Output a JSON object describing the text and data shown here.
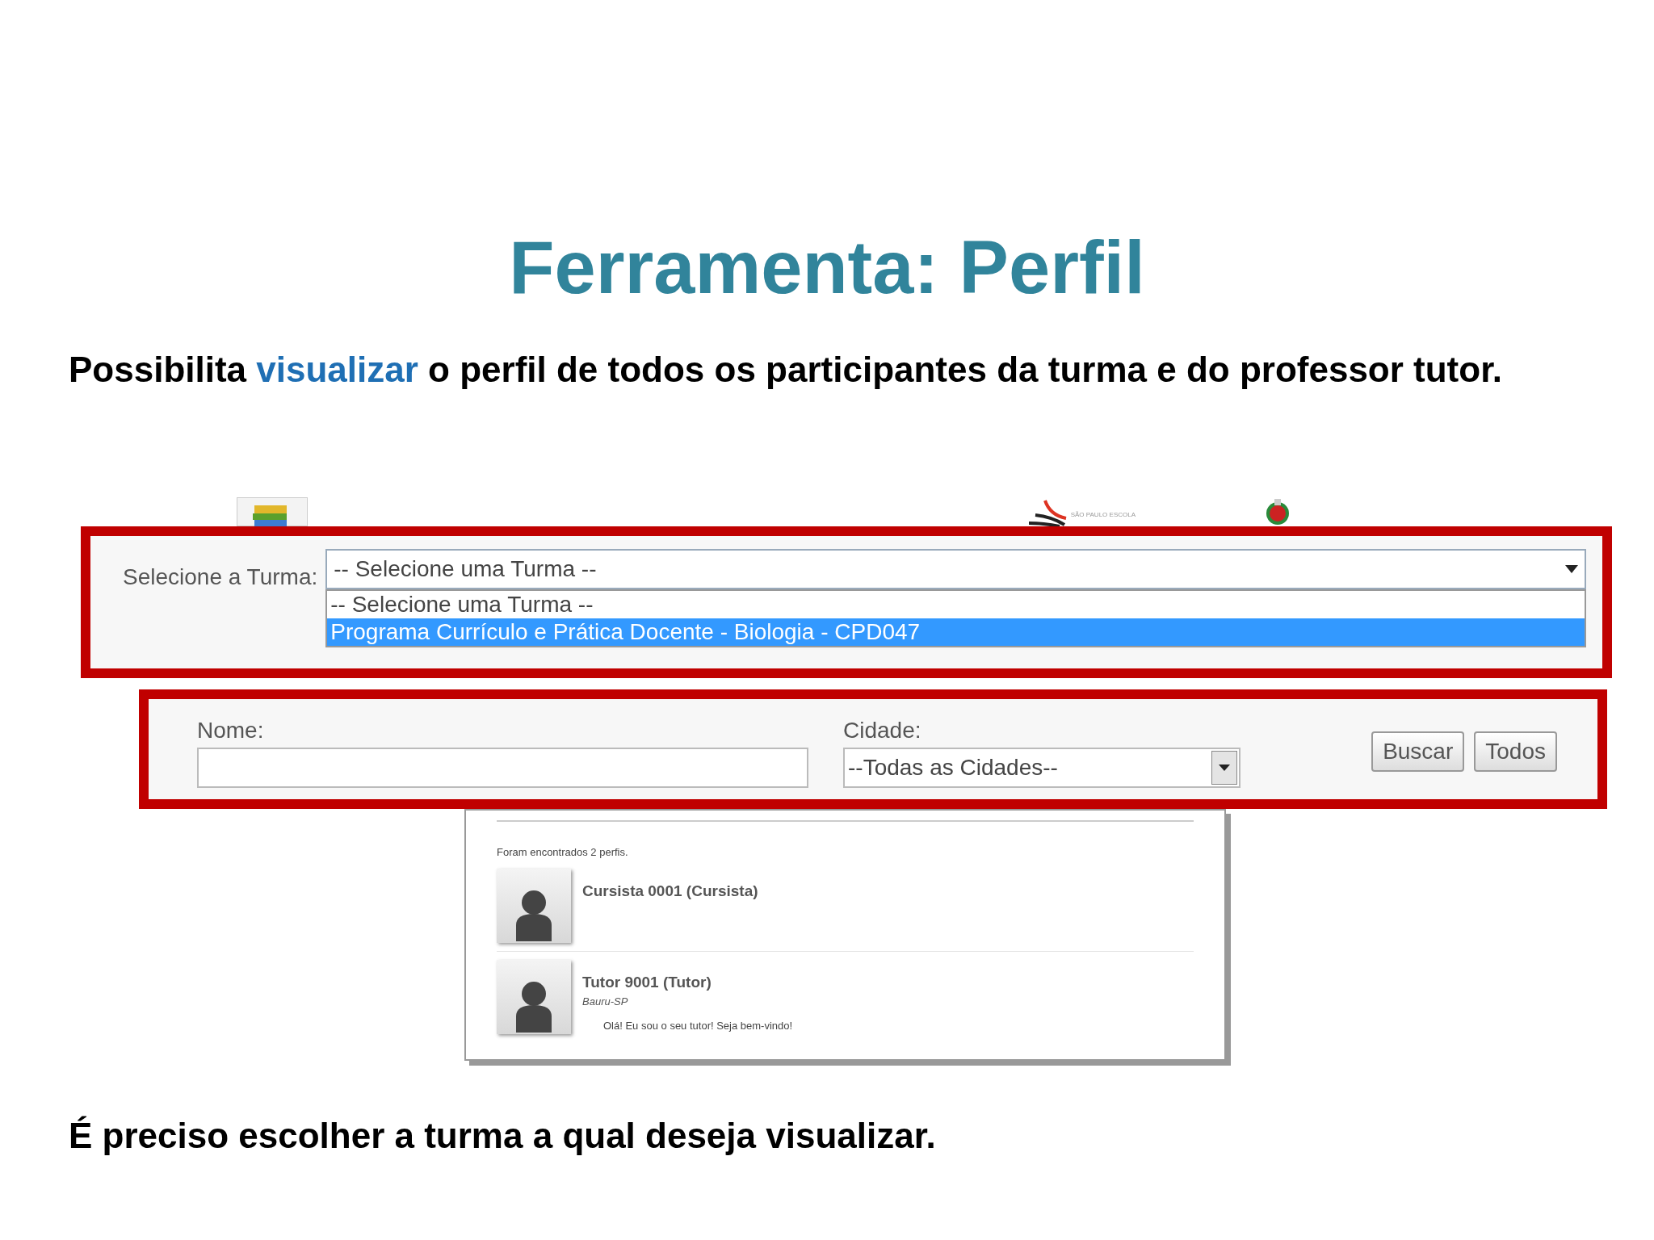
{
  "title": "Ferramenta: Perfil",
  "intro": [
    {
      "text": "Possibilita ",
      "kind": "plain"
    },
    {
      "text": "visualizar",
      "kind": "highlight"
    },
    {
      "text": " o perfil de todos os participantes da turma e do professor tutor.",
      "kind": "plain"
    }
  ],
  "header": {
    "logo_text": "SÃO PAULO ESCOLA"
  },
  "turma": {
    "label": "Selecione a Turma:",
    "value": "-- Selecione uma Turma --",
    "expanded": true,
    "options": [
      {
        "label": "-- Selecione uma Turma --",
        "highlighted": false
      },
      {
        "label": "Programa Currículo e Prática Docente - Biologia - CPD047",
        "highlighted": true
      }
    ]
  },
  "filters": {
    "name_label": "Nome:",
    "city_label": "Cidade:",
    "city_value": "--Todas as Cidades--",
    "buttons": [
      "Buscar",
      "Todos"
    ]
  },
  "results": {
    "summary": "Foram encontrados 2 perfis.",
    "profiles": [
      {
        "name": "Cursista 0001 (Cursista)"
      },
      {
        "name": "Tutor 9001 (Tutor)",
        "city": "Bauru-SP",
        "message": "Olá! Eu sou o seu tutor! Seja bem-vindo!"
      }
    ]
  },
  "footer": "É preciso escolher a turma a qual deseja visualizar."
}
